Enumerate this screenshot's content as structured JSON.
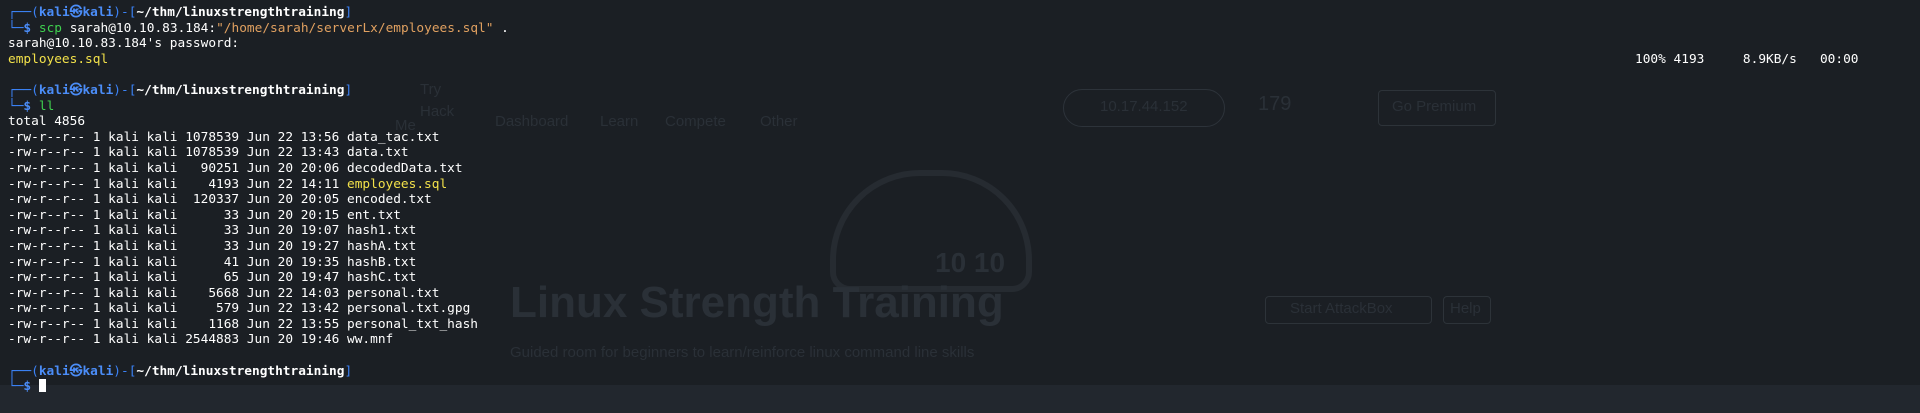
{
  "prompt": {
    "user": "kali",
    "host": "kali",
    "at_symbol": "㉿",
    "cwd": "~/thm/linuxstrengthtraining",
    "symbol": "$",
    "open_paren": "(",
    "close_bracket": ")-[",
    "end_bracket": "]",
    "corner_top": "┌──",
    "corner_bottom": "└─"
  },
  "scp": {
    "command": "scp",
    "source": "sarah@10.10.83.184:",
    "path_quoted": "\"/home/sarah/serverLx/employees.sql\"",
    "dest": ".",
    "password_prompt": "sarah@10.10.83.184's password:",
    "file": "employees.sql",
    "progress": "100%",
    "size": "4193",
    "speed": "8.9KB/s",
    "eta": "00:00"
  },
  "ll": {
    "command": "ll",
    "total": "total 4856",
    "entries": [
      {
        "meta": "-rw-r--r-- 1 kali kali 1078539 Jun 22 13:56 ",
        "name": "data_tac.txt",
        "highlight": false
      },
      {
        "meta": "-rw-r--r-- 1 kali kali 1078539 Jun 22 13:43 ",
        "name": "data.txt",
        "highlight": false
      },
      {
        "meta": "-rw-r--r-- 1 kali kali   90251 Jun 20 20:06 ",
        "name": "decodedData.txt",
        "highlight": false
      },
      {
        "meta": "-rw-r--r-- 1 kali kali    4193 Jun 22 14:11 ",
        "name": "employees.sql",
        "highlight": true
      },
      {
        "meta": "-rw-r--r-- 1 kali kali  120337 Jun 20 20:05 ",
        "name": "encoded.txt",
        "highlight": false
      },
      {
        "meta": "-rw-r--r-- 1 kali kali      33 Jun 20 20:15 ",
        "name": "ent.txt",
        "highlight": false
      },
      {
        "meta": "-rw-r--r-- 1 kali kali      33 Jun 20 19:07 ",
        "name": "hash1.txt",
        "highlight": false
      },
      {
        "meta": "-rw-r--r-- 1 kali kali      33 Jun 20 19:27 ",
        "name": "hashA.txt",
        "highlight": false
      },
      {
        "meta": "-rw-r--r-- 1 kali kali      41 Jun 20 19:35 ",
        "name": "hashB.txt",
        "highlight": false
      },
      {
        "meta": "-rw-r--r-- 1 kali kali      65 Jun 20 19:47 ",
        "name": "hashC.txt",
        "highlight": false
      },
      {
        "meta": "-rw-r--r-- 1 kali kali    5668 Jun 22 14:03 ",
        "name": "personal.txt",
        "highlight": false
      },
      {
        "meta": "-rw-r--r-- 1 kali kali     579 Jun 22 13:42 ",
        "name": "personal.txt.gpg",
        "highlight": false
      },
      {
        "meta": "-rw-r--r-- 1 kali kali    1168 Jun 22 13:55 ",
        "name": "personal_txt_hash",
        "highlight": false
      },
      {
        "meta": "-rw-r--r-- 1 kali kali 2544883 Jun 20 19:46 ",
        "name": "ww.mnf",
        "highlight": false
      }
    ]
  },
  "background_page": {
    "title": "Linux Strength Training",
    "subtitle": "Guided room for beginners to learn/reinforce linux command line skills",
    "nav": [
      "Dashboard",
      "Learn",
      "Compete",
      "Other"
    ],
    "ip": "10.17.44.152",
    "streak": "179",
    "premium": "Go Premium",
    "attackbox": "Start AttackBox",
    "help": "Help",
    "logo_try": "Try",
    "logo_hack": "Hack",
    "logo_me": "Me",
    "cloud_digits": "10  10"
  },
  "colors": {
    "background": "#1b1f24",
    "prompt_blue": "#3b82f6",
    "command_green": "#3fd14f",
    "string_orange": "#e0a060",
    "highlight_yellow": "#f2e14a"
  }
}
